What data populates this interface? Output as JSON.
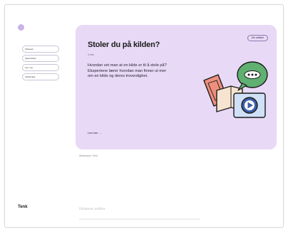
{
  "sidebar": {
    "items": [
      {
        "label": "Kildesøk"
      },
      {
        "label": "Sjekk kilden"
      },
      {
        "label": "Lær mer"
      },
      {
        "label": "Kildekritikk"
      }
    ]
  },
  "card": {
    "share_label": "Del artikkel",
    "title": "Stoler du på kilden?",
    "meta": "4 min",
    "lead": "Hvordan vet man at en kilde er til å stole på? Ekspertene lærer hvordan man finner ut mer om en kilde og deres troverdighet.",
    "read_more": "Les mer →"
  },
  "caption": "Illustrasjon: Tenk",
  "brand": "Tenk",
  "footer": {
    "title": "Relaterte artikler"
  },
  "colors": {
    "card_bg": "#e8d9f6",
    "bubble_green": "#5fb071",
    "play_blue": "#3d5ea8",
    "accent_salmon": "#ee8f7d"
  }
}
